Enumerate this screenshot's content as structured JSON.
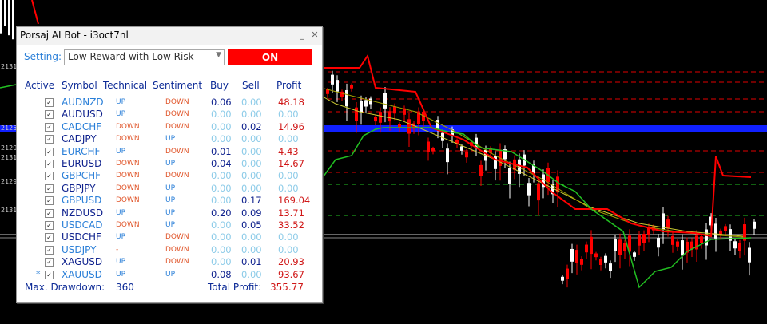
{
  "window": {
    "title": "Porsaj AI Bot - i3oct7nl"
  },
  "setting": {
    "label": "Setting:",
    "value": "Low Reward with Low Risk",
    "toggle_label": "ON"
  },
  "headers": {
    "active": "Active",
    "symbol": "Symbol",
    "technical": "Technical",
    "sentiment": "Sentiment",
    "buy": "Buy",
    "sell": "Sell",
    "profit": "Profit"
  },
  "rows": [
    {
      "symbol": "AUDNZD",
      "technical": "UP",
      "sentiment": "DOWN",
      "buy": "0.06",
      "sell": "0.00",
      "profit": "48.18",
      "marked": false
    },
    {
      "symbol": "AUDUSD",
      "technical": "UP",
      "sentiment": "DOWN",
      "buy": "0.00",
      "sell": "0.00",
      "profit": "0.00",
      "marked": false
    },
    {
      "symbol": "CADCHF",
      "technical": "DOWN",
      "sentiment": "DOWN",
      "buy": "0.00",
      "sell": "0.02",
      "profit": "14.96",
      "marked": false
    },
    {
      "symbol": "CADJPY",
      "technical": "DOWN",
      "sentiment": "UP",
      "buy": "0.00",
      "sell": "0.00",
      "profit": "0.00",
      "marked": false
    },
    {
      "symbol": "EURCHF",
      "technical": "UP",
      "sentiment": "DOWN",
      "buy": "0.01",
      "sell": "0.00",
      "profit": "4.43",
      "marked": false
    },
    {
      "symbol": "EURUSD",
      "technical": "DOWN",
      "sentiment": "UP",
      "buy": "0.04",
      "sell": "0.00",
      "profit": "14.67",
      "marked": false
    },
    {
      "symbol": "GBPCHF",
      "technical": "DOWN",
      "sentiment": "DOWN",
      "buy": "0.00",
      "sell": "0.00",
      "profit": "0.00",
      "marked": false
    },
    {
      "symbol": "GBPJPY",
      "technical": "DOWN",
      "sentiment": "UP",
      "buy": "0.00",
      "sell": "0.00",
      "profit": "0.00",
      "marked": false
    },
    {
      "symbol": "GBPUSD",
      "technical": "DOWN",
      "sentiment": "UP",
      "buy": "0.00",
      "sell": "0.17",
      "profit": "169.04",
      "marked": false
    },
    {
      "symbol": "NZDUSD",
      "technical": "UP",
      "sentiment": "UP",
      "buy": "0.20",
      "sell": "0.09",
      "profit": "13.71",
      "marked": false
    },
    {
      "symbol": "USDCAD",
      "technical": "DOWN",
      "sentiment": "UP",
      "buy": "0.00",
      "sell": "0.05",
      "profit": "33.52",
      "marked": false
    },
    {
      "symbol": "USDCHF",
      "technical": "UP",
      "sentiment": "DOWN",
      "buy": "0.00",
      "sell": "0.00",
      "profit": "0.00",
      "marked": false
    },
    {
      "symbol": "USDJPY",
      "technical": "-",
      "sentiment": "DOWN",
      "buy": "0.00",
      "sell": "0.00",
      "profit": "0.00",
      "marked": false
    },
    {
      "symbol": "XAGUSD",
      "technical": "UP",
      "sentiment": "DOWN",
      "buy": "0.00",
      "sell": "0.01",
      "profit": "20.93",
      "marked": false
    },
    {
      "symbol": "XAUUSD",
      "technical": "UP",
      "sentiment": "UP",
      "buy": "0.08",
      "sell": "0.00",
      "profit": "93.67",
      "marked": true
    }
  ],
  "marker": "*",
  "footer": {
    "drawdown_label": "Max. Drawdown:",
    "drawdown_value": "360",
    "total_label": "Total Profit:",
    "total_value": "355.77"
  },
  "axis_labels": [
    "2131",
    "2125",
    "2129",
    "2131",
    "2129",
    "2131"
  ],
  "colors": {
    "up": "#2a7fd8",
    "down": "#e0552a",
    "active_positive": "#d01818",
    "zero": "#8ccbe8",
    "symbol_dark": "#0c1f8c",
    "symbol_light": "#2a7fd8"
  }
}
